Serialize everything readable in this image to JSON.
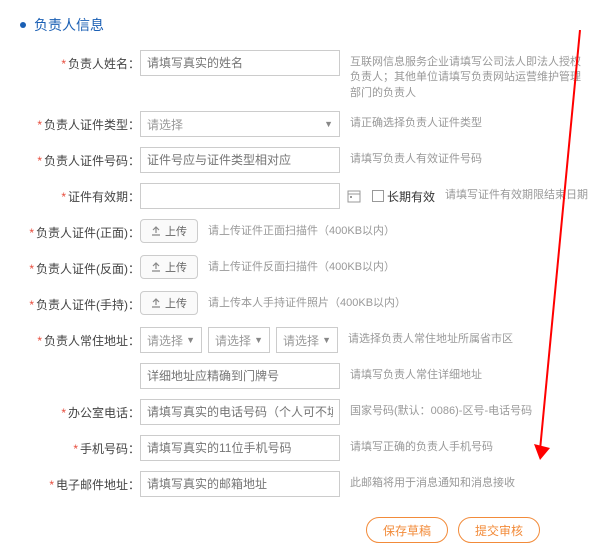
{
  "section_title": "负责人信息",
  "fields": {
    "name": {
      "label": "负责人姓名：",
      "placeholder": "请填写真实的姓名",
      "hint": "互联网信息服务企业请填写公司法人即法人授权负责人；其他单位请填写负责网站运营维护管理部门的负责人"
    },
    "id_type": {
      "label": "负责人证件类型：",
      "placeholder": "请选择",
      "hint": "请正确选择负责人证件类型"
    },
    "id_number": {
      "label": "负责人证件号码：",
      "placeholder": "证件号应与证件类型相对应",
      "hint": "请填写负责人有效证件号码"
    },
    "id_expire": {
      "label": "证件有效期：",
      "checkbox": "长期有效",
      "hint": "请填写证件有效期限结束日期"
    },
    "id_front": {
      "label": "负责人证件(正面)：",
      "btn": "上传",
      "hint": "请上传证件正面扫描件（400KB以内）"
    },
    "id_back": {
      "label": "负责人证件(反面)：",
      "btn": "上传",
      "hint": "请上传证件反面扫描件（400KB以内）"
    },
    "id_hold": {
      "label": "负责人证件(手持)：",
      "btn": "上传",
      "hint": "请上传本人手持证件照片（400KB以内）"
    },
    "address": {
      "label": "负责人常住地址：",
      "sel": "请选择",
      "hint": "请选择负责人常住地址所属省市区",
      "detail_placeholder": "详细地址应精确到门牌号",
      "detail_hint": "请填写负责人常住详细地址"
    },
    "office_phone": {
      "label": "办公室电话：",
      "placeholder": "请填写真实的电话号码（个人可不填）",
      "hint": "国家号码(默认：0086)-区号-电话号码"
    },
    "mobile": {
      "label": "手机号码：",
      "placeholder": "请填写真实的11位手机号码",
      "hint": "请填写正确的负责人手机号码"
    },
    "email": {
      "label": "电子邮件地址：",
      "placeholder": "请填写真实的邮箱地址",
      "hint": "此邮箱将用于消息通知和消息接收"
    }
  },
  "buttons": {
    "save_draft": "保存草稿",
    "submit": "提交审核"
  }
}
